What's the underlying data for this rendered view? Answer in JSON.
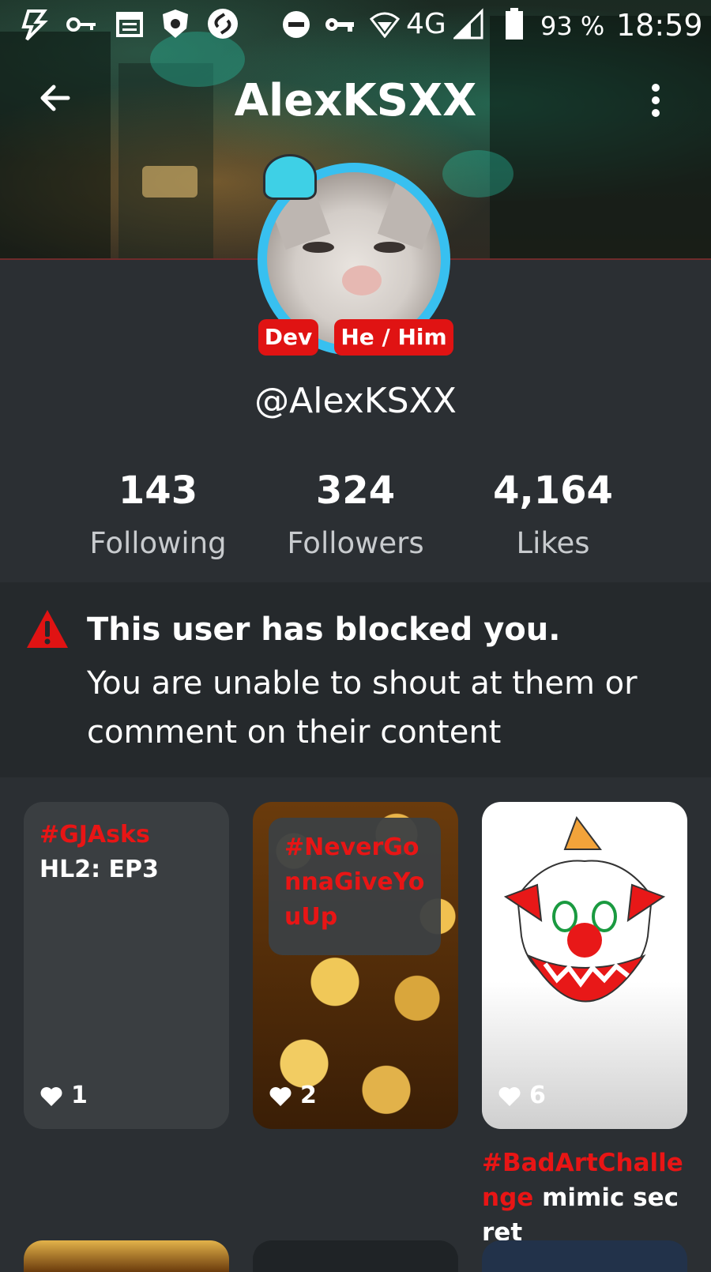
{
  "status_bar": {
    "network": "4G",
    "battery": "93 %",
    "time": "18:59",
    "icons": [
      "lightning-icon",
      "key-icon",
      "calendar-icon",
      "shield-icon",
      "shazam-icon",
      "dnd-icon",
      "vpn-key-icon",
      "wifi-icon",
      "signal-icon",
      "battery-icon"
    ]
  },
  "header": {
    "title": "AlexKSXX",
    "back_icon": "arrow-left-icon",
    "menu_icon": "more-vert-icon"
  },
  "profile": {
    "badges": [
      "Dev",
      "He / Him"
    ],
    "handle": "@AlexKSXX",
    "stats": [
      {
        "value": "143",
        "label": "Following"
      },
      {
        "value": "324",
        "label": "Followers"
      },
      {
        "value": "4,164",
        "label": "Likes"
      }
    ],
    "ring_color": "#38c0f0",
    "badge_color": "#e01313"
  },
  "block_notice": {
    "title": "This user has blocked you.",
    "description": "You are unable to shout at them or comment on their content",
    "icon": "warning-icon"
  },
  "posts": [
    {
      "tag": "#GJAsks",
      "text": " HL2: EP3",
      "likes": "1"
    },
    {
      "tag": "#NeverGonnaGiveYouUp",
      "text": "",
      "likes": "2"
    },
    {
      "tag": "#BadArtChallenge",
      "text": " mimic secret",
      "likes": "6"
    }
  ]
}
